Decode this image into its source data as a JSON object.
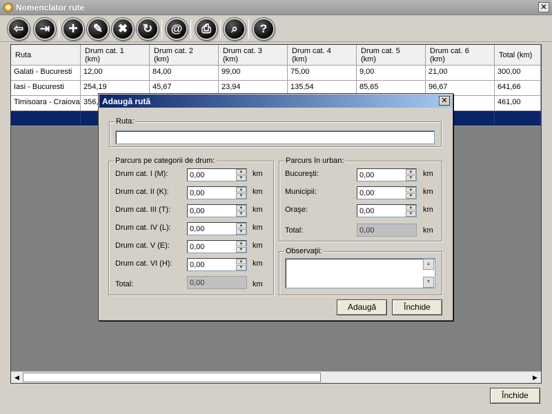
{
  "window": {
    "title": "Nomenclator rute",
    "close_glyph": "✕"
  },
  "toolbar": {
    "buttons": [
      {
        "name": "back",
        "icon": "arrow-left-icon",
        "glyph": "⇦"
      },
      {
        "name": "exit",
        "icon": "exit-icon",
        "glyph": "⇥"
      },
      {
        "name": "add",
        "icon": "plus-icon",
        "glyph": "+"
      },
      {
        "name": "edit",
        "icon": "pencil-icon",
        "glyph": "✎"
      },
      {
        "name": "delete",
        "icon": "x-icon",
        "glyph": "✖"
      },
      {
        "name": "refresh",
        "icon": "refresh-icon",
        "glyph": "↻"
      },
      {
        "name": "email",
        "icon": "at-icon",
        "glyph": "@"
      },
      {
        "name": "print",
        "icon": "printer-icon",
        "glyph": "⎙"
      },
      {
        "name": "search",
        "icon": "magnifier-icon",
        "glyph": "⌕"
      },
      {
        "name": "help",
        "icon": "help-icon",
        "glyph": "?"
      }
    ]
  },
  "grid": {
    "columns": [
      {
        "line1": "Ruta",
        "line2": ""
      },
      {
        "line1": "Drum cat. 1",
        "line2": "(km)"
      },
      {
        "line1": "Drum cat. 2",
        "line2": "(km)"
      },
      {
        "line1": "Drum cat. 3",
        "line2": "(km)"
      },
      {
        "line1": "Drum cat. 4",
        "line2": "(km)"
      },
      {
        "line1": "Drum cat. 5",
        "line2": "(km)"
      },
      {
        "line1": "Drum cat. 6",
        "line2": "(km)"
      },
      {
        "line1": "Total (km)",
        "line2": ""
      }
    ],
    "rows": [
      [
        "Galati - Bucuresti",
        "12,00",
        "84,00",
        "99,00",
        "75,00",
        "9,00",
        "21,00",
        "300,00"
      ],
      [
        "Iasi - Bucuresti",
        "254,19",
        "45,67",
        "23,94",
        "135,54",
        "85,65",
        "96,67",
        "641,66"
      ],
      [
        "Timisoara - Craiova",
        "356,",
        "",
        "",
        "",
        "",
        "",
        "461,00"
      ]
    ]
  },
  "bottom": {
    "close_label": "Închide"
  },
  "dialog": {
    "title": "Adaugă rută",
    "close_glyph": "✕",
    "route": {
      "label": "Ruta:",
      "value": ""
    },
    "road_group": {
      "legend": "Parcurs pe categorii de drum:",
      "fields": [
        {
          "label": "Drum cat. I (M):",
          "value": "0,00",
          "unit": "km"
        },
        {
          "label": "Drum cat. II (K):",
          "value": "0,00",
          "unit": "km"
        },
        {
          "label": "Drum cat. III (T):",
          "value": "0,00",
          "unit": "km"
        },
        {
          "label": "Drum cat. IV (L):",
          "value": "0,00",
          "unit": "km"
        },
        {
          "label": "Drum cat. V (E):",
          "value": "0,00",
          "unit": "km"
        },
        {
          "label": "Drum cat. VI (H):",
          "value": "0,00",
          "unit": "km"
        }
      ],
      "total_label": "Total:",
      "total_value": "0,00",
      "total_unit": "km"
    },
    "urban_group": {
      "legend": "Parcurs în urban:",
      "fields": [
        {
          "label": "Bucureşti:",
          "value": "0,00",
          "unit": "km"
        },
        {
          "label": "Municipii:",
          "value": "0,00",
          "unit": "km"
        },
        {
          "label": "Oraşe:",
          "value": "0,00",
          "unit": "km"
        }
      ],
      "total_label": "Total:",
      "total_value": "0,00",
      "total_unit": "km"
    },
    "notes": {
      "legend": "Observaţii:",
      "value": ""
    },
    "add_label": "Adaugă",
    "close_label": "Închide"
  }
}
